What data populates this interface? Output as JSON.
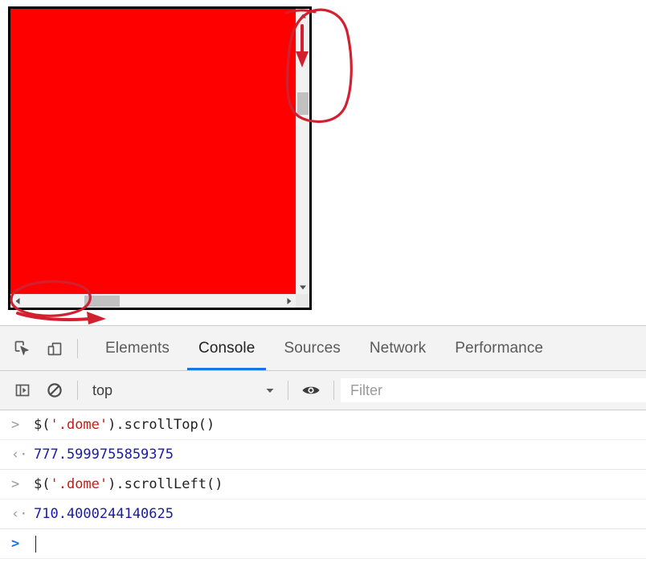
{
  "page": {
    "scroll_box": {
      "content_color": "#ff0000",
      "border_color": "#000000",
      "vertical_scrollbar": {
        "up_arrow_icon": "triangle-up-icon",
        "down_arrow_icon": "triangle-down-icon",
        "thumb_label": "vertical-scroll-thumb"
      },
      "horizontal_scrollbar": {
        "left_arrow_icon": "triangle-left-icon",
        "right_arrow_icon": "triangle-right-icon",
        "thumb_label": "horizontal-scroll-thumb"
      }
    },
    "annotations": {
      "color": "#d32030",
      "vertical_callout": "ellipse-around-vertical-scrollbar-with-down-arrow",
      "horizontal_callout": "ellipse-around-horizontal-scrollbar-with-right-arrow"
    }
  },
  "devtools": {
    "toolbar_icons": [
      {
        "name": "inspect-element-icon",
        "title": "Inspect"
      },
      {
        "name": "device-toolbar-icon",
        "title": "Toggle device toolbar"
      }
    ],
    "tabs": [
      {
        "label": "Elements",
        "active": false
      },
      {
        "label": "Console",
        "active": true
      },
      {
        "label": "Sources",
        "active": false
      },
      {
        "label": "Network",
        "active": false
      },
      {
        "label": "Performance",
        "active": false
      }
    ],
    "active_tab_accent": "#1a73e8",
    "console_toolbar": {
      "sidebar_icon": "console-sidebar-icon",
      "clear_icon": "clear-console-icon",
      "context_value": "top",
      "context_dropdown_icon": "chevron-down-icon",
      "eye_icon": "live-expression-eye-icon",
      "filter_placeholder": "Filter"
    },
    "console_rows": [
      {
        "type": "input",
        "marker": ">",
        "segments": [
          {
            "text": "$(",
            "style": "plain"
          },
          {
            "text": "'.dome'",
            "style": "string"
          },
          {
            "text": ").scrollTop()",
            "style": "plain"
          }
        ]
      },
      {
        "type": "result",
        "marker": "‹·",
        "value": "777.5999755859375"
      },
      {
        "type": "input",
        "marker": ">",
        "segments": [
          {
            "text": "$(",
            "style": "plain"
          },
          {
            "text": "'.dome'",
            "style": "string"
          },
          {
            "text": ").scrollLeft()",
            "style": "plain"
          }
        ]
      },
      {
        "type": "result",
        "marker": "‹·",
        "value": "710.4000244140625"
      },
      {
        "type": "prompt",
        "marker": ">",
        "value": ""
      }
    ]
  }
}
